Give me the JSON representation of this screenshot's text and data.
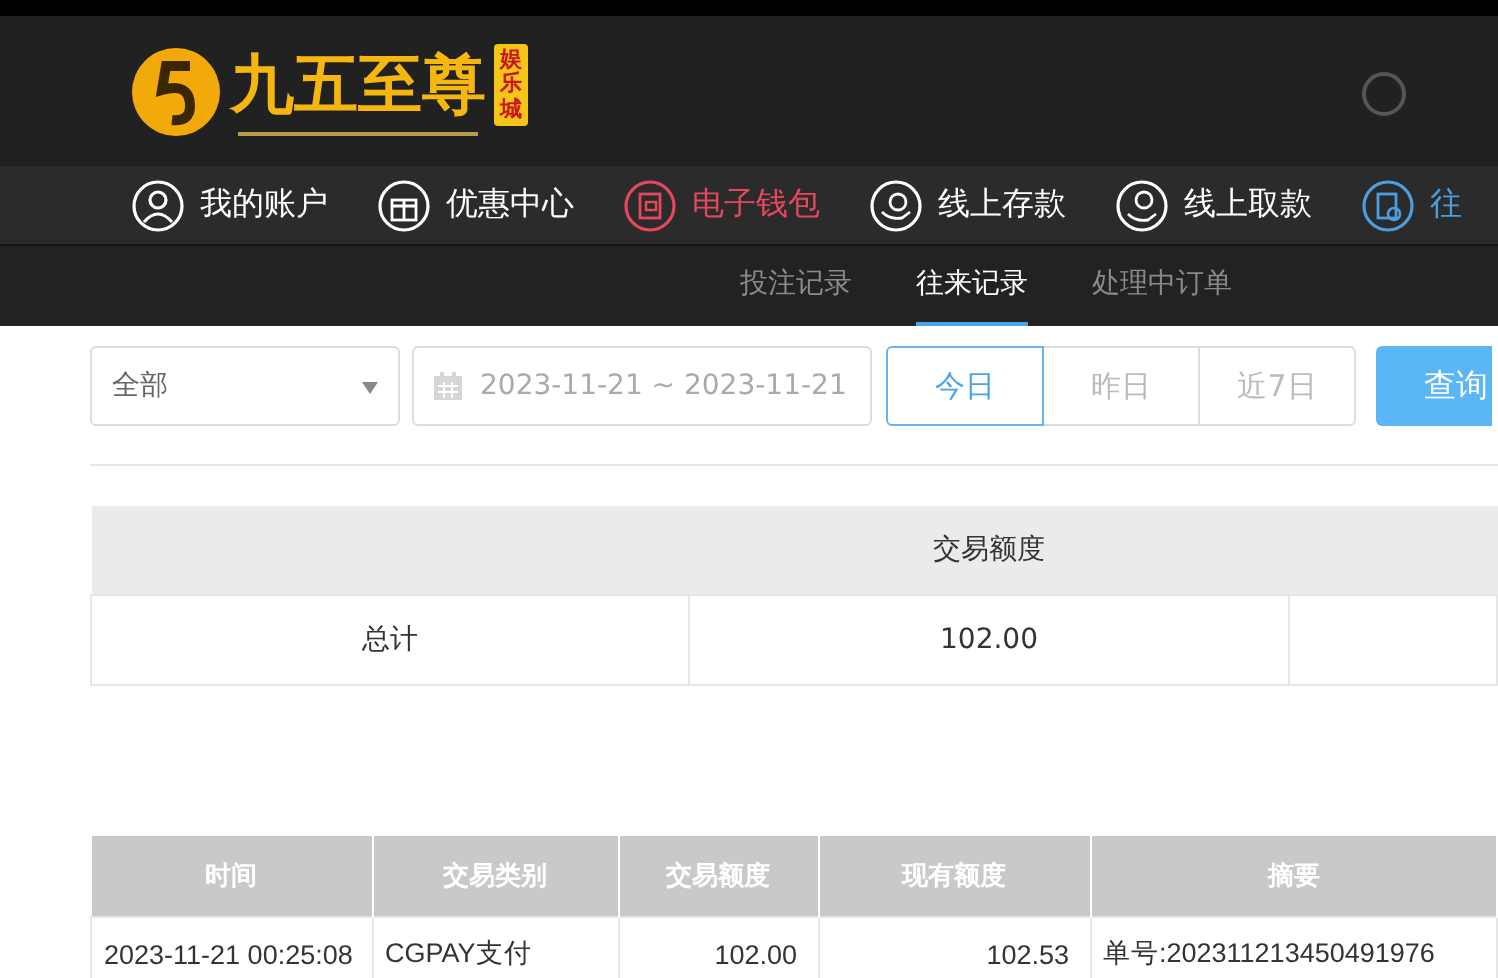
{
  "header": {
    "logo": {
      "title": "九五至尊",
      "badge": "娱乐城"
    }
  },
  "nav": [
    {
      "label": "我的账户",
      "color": "#ffffff"
    },
    {
      "label": "优惠中心",
      "color": "#ffffff"
    },
    {
      "label": "电子钱包",
      "color": "#e5485e"
    },
    {
      "label": "线上存款",
      "color": "#ffffff"
    },
    {
      "label": "线上取款",
      "color": "#ffffff"
    },
    {
      "label": "往",
      "color": "#4a9fe0"
    }
  ],
  "sub_tabs": [
    {
      "label": "投注记录",
      "selected": false
    },
    {
      "label": "往来记录",
      "selected": true
    },
    {
      "label": "处理中订单",
      "selected": false
    }
  ],
  "filters": {
    "type_select": "全部",
    "date_range": "2023-11-21 ~ 2023-11-21",
    "quick_ranges": [
      {
        "label": "今日",
        "selected": true
      },
      {
        "label": "昨日",
        "selected": false
      },
      {
        "label": "近7日",
        "selected": false
      }
    ],
    "query_button": "查询"
  },
  "summary": {
    "columns": [
      "",
      "交易额度"
    ],
    "rows": [
      [
        "总计",
        "102.00"
      ]
    ]
  },
  "records": {
    "columns": [
      "时间",
      "交易类别",
      "交易额度",
      "现有额度",
      "摘要"
    ],
    "rows": [
      [
        "2023-11-21 00:25:08",
        "CGPAY支付",
        "102.00",
        "102.53",
        "单号:202311213450491976"
      ]
    ]
  }
}
